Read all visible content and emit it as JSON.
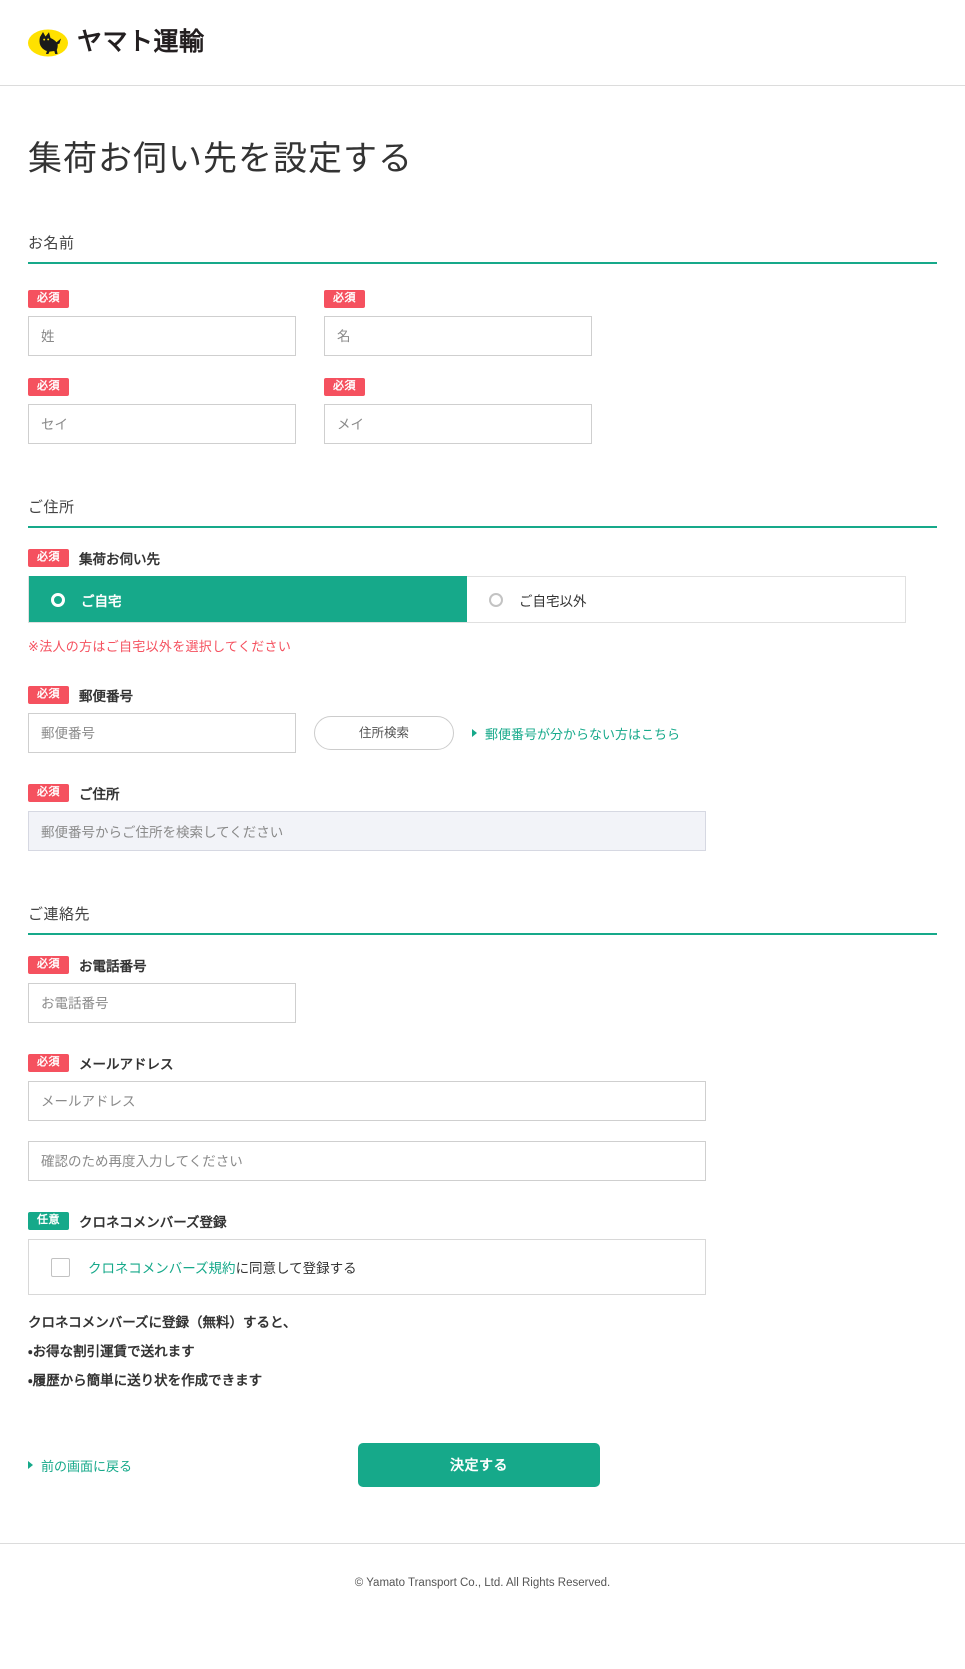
{
  "header": {
    "brand_name": "ヤマト運輸",
    "logo_icon": "yamato-cat-logo",
    "logo_bg_color": "#ffe100"
  },
  "page": {
    "title": "集荷お伺い先を設定する"
  },
  "theme": {
    "accent_teal": "#16a98a",
    "required_red": "#f5515f",
    "warning_red": "#f5515f"
  },
  "sections": {
    "name": {
      "heading": "お名前",
      "fields": [
        {
          "badge": "必須",
          "placeholder": "姓"
        },
        {
          "badge": "必須",
          "placeholder": "名"
        },
        {
          "badge": "必須",
          "placeholder": "セイ"
        },
        {
          "badge": "必須",
          "placeholder": "メイ"
        }
      ]
    },
    "address": {
      "heading": "ご住所",
      "pickup_label": {
        "badge": "必須",
        "text": "集荷お伺い先"
      },
      "pickup_options": [
        {
          "label": "ご自宅",
          "selected": true
        },
        {
          "label": "ご自宅以外",
          "selected": false
        }
      ],
      "warning": "※法人の方はご自宅以外を選択してください",
      "zip_label": {
        "badge": "必須",
        "text": "郵便番号"
      },
      "zip_placeholder": "郵便番号",
      "zip_search_button": "住所検索",
      "zip_help_link": "郵便番号が分からない方はこちら",
      "address_label": {
        "badge": "必須",
        "text": "ご住所"
      },
      "address_disabled_text": "郵便番号からご住所を検索してください"
    },
    "contact": {
      "heading": "ご連絡先",
      "phone_label": {
        "badge": "必須",
        "text": "お電話番号"
      },
      "phone_placeholder": "お電話番号",
      "email_label": {
        "badge": "必須",
        "text": "メールアドレス"
      },
      "email_placeholder": "メールアドレス",
      "email_confirm_placeholder": "確認のため再度入力してください",
      "members_label": {
        "badge": "任意",
        "text": "クロネコメンバーズ登録"
      },
      "members_agree_link": "クロネコメンバーズ規約",
      "members_agree_rest": "に同意して登録する",
      "benefit_lead": "クロネコメンバーズに登録（無料）すると、",
      "benefits": [
        "・お得な割引運賃で送れます",
        "・履歴から簡単に送り状を作成できます"
      ]
    }
  },
  "actions": {
    "back_link": "前の画面に戻る",
    "submit_button": "決定する"
  },
  "footer": {
    "copyright": "© Yamato Transport Co., Ltd. All Rights Reserved."
  }
}
